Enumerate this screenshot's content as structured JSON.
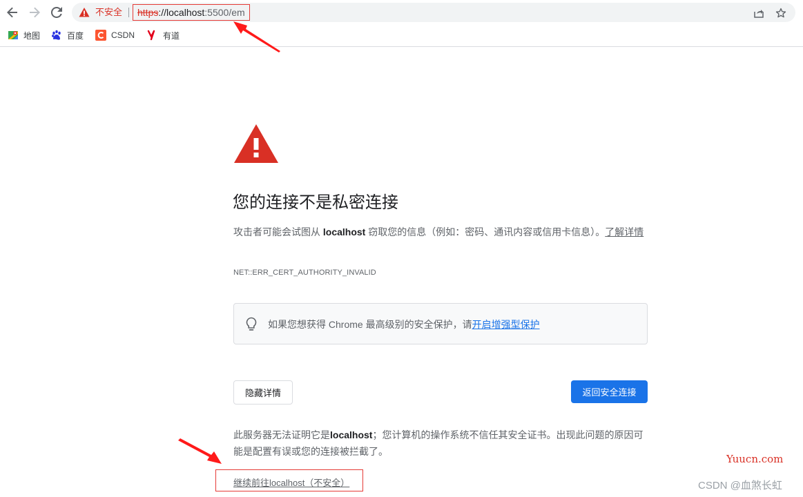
{
  "toolbar": {
    "security_label": "不安全",
    "url_scheme": "https",
    "url_host": "://localhost",
    "url_path": ":5500/em"
  },
  "bookmarks": [
    {
      "label": "地图",
      "icon": "maps-icon"
    },
    {
      "label": "百度",
      "icon": "baidu-icon"
    },
    {
      "label": "CSDN",
      "icon": "csdn-icon"
    },
    {
      "label": "有道",
      "icon": "youdao-icon"
    }
  ],
  "interstitial": {
    "heading": "您的连接不是私密连接",
    "desc_pre": "攻击者可能会试图从 ",
    "desc_host": "localhost",
    "desc_post": " 窃取您的信息（例如：密码、通讯内容或信用卡信息）。",
    "learn_more": "了解详情",
    "error_code": "NET::ERR_CERT_AUTHORITY_INVALID",
    "enhanced_text": "如果您想获得 Chrome 最高级别的安全保护，请",
    "enhanced_link": "开启增强型保护",
    "hide_details": "隐藏详情",
    "back_to_safety": "返回安全连接",
    "detail_pre": "此服务器无法证明它是",
    "detail_host": "localhost",
    "detail_post": "；您计算机的操作系统不信任其安全证书。出现此问题的原因可能是配置有误或您的连接被拦截了。",
    "proceed_link": "继续前往localhost（不安全）"
  },
  "watermarks": {
    "site": "Yuucn.com",
    "author": "CSDN @血煞长虹"
  },
  "colors": {
    "warning_red": "#d93025",
    "primary_blue": "#1a73e8",
    "annotation_red": "#e53935"
  }
}
